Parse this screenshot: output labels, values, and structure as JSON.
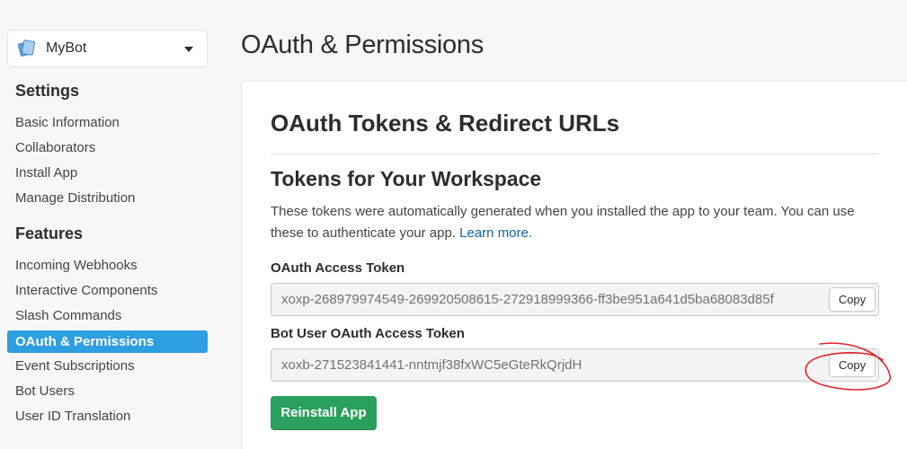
{
  "app": {
    "name": "MyBot"
  },
  "sidebar": {
    "settings_title": "Settings",
    "settings_items": [
      {
        "label": "Basic Information"
      },
      {
        "label": "Collaborators"
      },
      {
        "label": "Install App"
      },
      {
        "label": "Manage Distribution"
      }
    ],
    "features_title": "Features",
    "features_items": [
      {
        "label": "Incoming Webhooks"
      },
      {
        "label": "Interactive Components"
      },
      {
        "label": "Slash Commands"
      },
      {
        "label": "OAuth & Permissions",
        "active": true
      },
      {
        "label": "Event Subscriptions"
      },
      {
        "label": "Bot Users"
      },
      {
        "label": "User ID Translation"
      }
    ]
  },
  "main": {
    "page_title": "OAuth & Permissions",
    "card_title": "OAuth Tokens & Redirect URLs",
    "section_title": "Tokens for Your Workspace",
    "description": "These tokens were automatically generated when you installed the app to your team. You can use these to authenticate your app.",
    "learn_more": "Learn more.",
    "oauth_token": {
      "label": "OAuth Access Token",
      "value": "xoxp-268979974549-269920508615-272918999366-ff3be951a641d5ba68083d85f",
      "copy_label": "Copy"
    },
    "bot_token": {
      "label": "Bot User OAuth Access Token",
      "value": "xoxb-271523841441-nntmjf38fxWC5eGteRkQrjdH",
      "copy_label": "Copy"
    },
    "reinstall_label": "Reinstall App"
  },
  "colors": {
    "active_nav": "#2d9ee0",
    "link": "#1264a3",
    "reinstall": "#2aa05d",
    "annotation": "#e0222a"
  }
}
